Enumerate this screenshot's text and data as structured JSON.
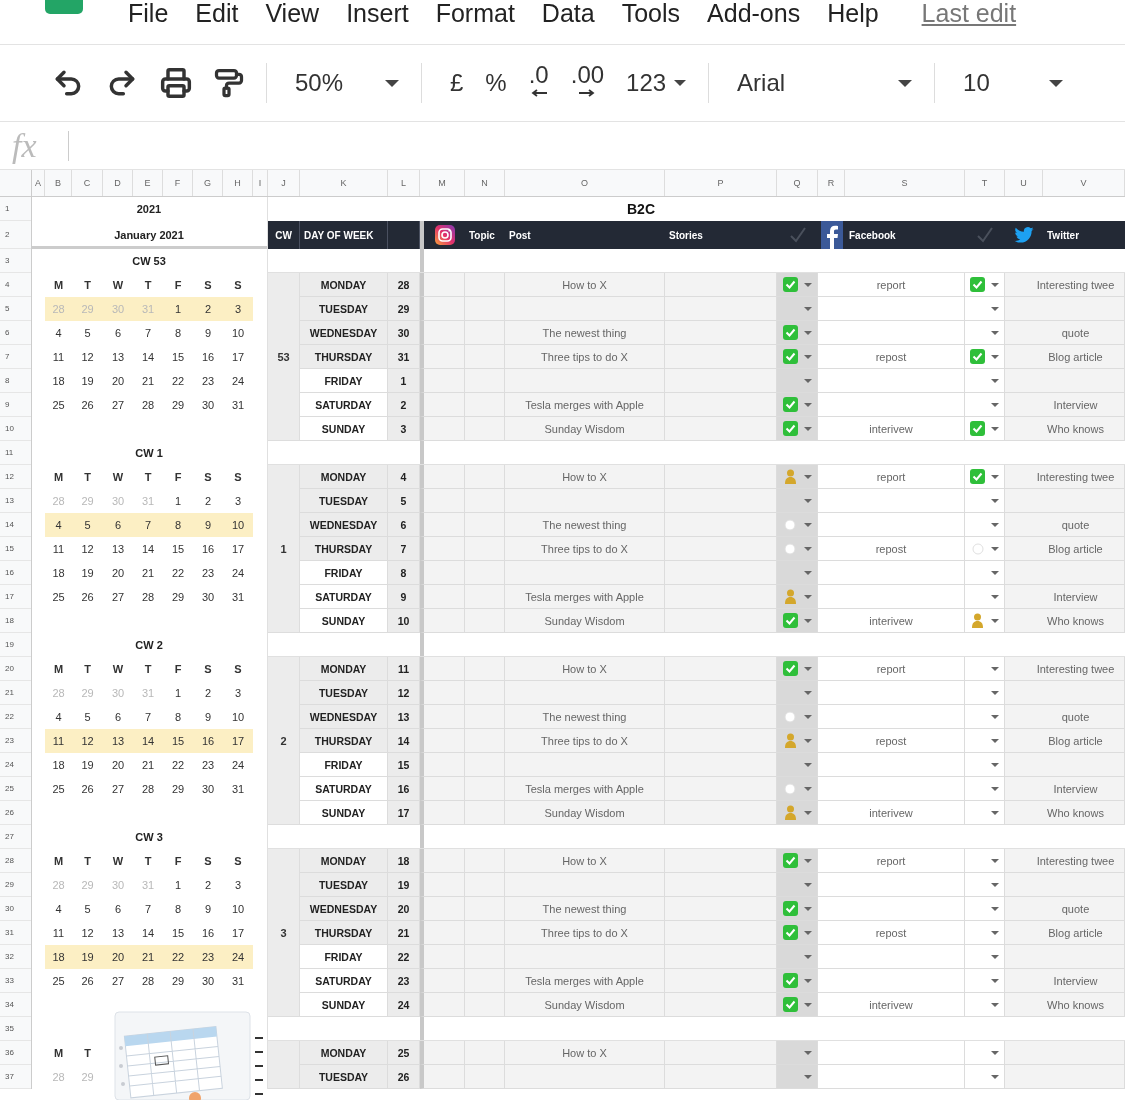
{
  "menu": {
    "items": [
      "File",
      "Edit",
      "View",
      "Insert",
      "Format",
      "Data",
      "Tools",
      "Add-ons",
      "Help"
    ],
    "last_edit": "Last edit"
  },
  "toolbar": {
    "zoom": "50%",
    "currency": "£",
    "percent": "%",
    "decrease_decimals": ".0",
    "increase_decimals": ".00",
    "number_format": "123",
    "font": "Arial",
    "font_size": "10"
  },
  "formula_bar": {
    "label": "fx"
  },
  "columns": [
    "A",
    "B",
    "C",
    "D",
    "E",
    "F",
    "G",
    "H",
    "I",
    "J",
    "K",
    "L",
    "M",
    "N",
    "O",
    "P",
    "Q",
    "R",
    "S",
    "T",
    "U",
    "V"
  ],
  "row_numbers": [
    "1",
    "2",
    "3",
    "4",
    "5",
    "6",
    "7",
    "8",
    "9",
    "10",
    "11",
    "12",
    "13",
    "14",
    "15",
    "16",
    "17",
    "18",
    "19",
    "20",
    "21",
    "22",
    "23",
    "24",
    "25",
    "26",
    "27",
    "28",
    "29",
    "30",
    "31",
    "32",
    "33",
    "34",
    "35",
    "36",
    "37"
  ],
  "calendar": {
    "year": "2021",
    "month": "January 2021",
    "blocks": [
      {
        "title": "CW 53",
        "headers": [
          "M",
          "T",
          "W",
          "T",
          "F",
          "S",
          "S"
        ],
        "weeks": [
          {
            "days": [
              "28",
              "29",
              "30",
              "31",
              "1",
              "2",
              "3"
            ],
            "muted": [
              true,
              true,
              true,
              true,
              false,
              false,
              false
            ],
            "highlighted": true
          },
          {
            "days": [
              "4",
              "5",
              "6",
              "7",
              "8",
              "9",
              "10"
            ],
            "muted": [
              false,
              false,
              false,
              false,
              false,
              false,
              false
            ],
            "highlighted": false
          },
          {
            "days": [
              "11",
              "12",
              "13",
              "14",
              "15",
              "16",
              "17"
            ],
            "muted": [
              false,
              false,
              false,
              false,
              false,
              false,
              false
            ],
            "highlighted": false
          },
          {
            "days": [
              "18",
              "19",
              "20",
              "21",
              "22",
              "23",
              "24"
            ],
            "muted": [
              false,
              false,
              false,
              false,
              false,
              false,
              false
            ],
            "highlighted": false
          },
          {
            "days": [
              "25",
              "26",
              "27",
              "28",
              "29",
              "30",
              "31"
            ],
            "muted": [
              false,
              false,
              false,
              false,
              false,
              false,
              false
            ],
            "highlighted": false
          }
        ]
      },
      {
        "title": "CW 1",
        "headers": [
          "M",
          "T",
          "W",
          "T",
          "F",
          "S",
          "S"
        ],
        "weeks": [
          {
            "days": [
              "28",
              "29",
              "30",
              "31",
              "1",
              "2",
              "3"
            ],
            "muted": [
              true,
              true,
              true,
              true,
              false,
              false,
              false
            ],
            "highlighted": false
          },
          {
            "days": [
              "4",
              "5",
              "6",
              "7",
              "8",
              "9",
              "10"
            ],
            "muted": [
              false,
              false,
              false,
              false,
              false,
              false,
              false
            ],
            "highlighted": true
          },
          {
            "days": [
              "11",
              "12",
              "13",
              "14",
              "15",
              "16",
              "17"
            ],
            "muted": [
              false,
              false,
              false,
              false,
              false,
              false,
              false
            ],
            "highlighted": false
          },
          {
            "days": [
              "18",
              "19",
              "20",
              "21",
              "22",
              "23",
              "24"
            ],
            "muted": [
              false,
              false,
              false,
              false,
              false,
              false,
              false
            ],
            "highlighted": false
          },
          {
            "days": [
              "25",
              "26",
              "27",
              "28",
              "29",
              "30",
              "31"
            ],
            "muted": [
              false,
              false,
              false,
              false,
              false,
              false,
              false
            ],
            "highlighted": false
          }
        ]
      },
      {
        "title": "CW 2",
        "headers": [
          "M",
          "T",
          "W",
          "T",
          "F",
          "S",
          "S"
        ],
        "weeks": [
          {
            "days": [
              "28",
              "29",
              "30",
              "31",
              "1",
              "2",
              "3"
            ],
            "muted": [
              true,
              true,
              true,
              true,
              false,
              false,
              false
            ],
            "highlighted": false
          },
          {
            "days": [
              "4",
              "5",
              "6",
              "7",
              "8",
              "9",
              "10"
            ],
            "muted": [
              false,
              false,
              false,
              false,
              false,
              false,
              false
            ],
            "highlighted": false
          },
          {
            "days": [
              "11",
              "12",
              "13",
              "14",
              "15",
              "16",
              "17"
            ],
            "muted": [
              false,
              false,
              false,
              false,
              false,
              false,
              false
            ],
            "highlighted": true
          },
          {
            "days": [
              "18",
              "19",
              "20",
              "21",
              "22",
              "23",
              "24"
            ],
            "muted": [
              false,
              false,
              false,
              false,
              false,
              false,
              false
            ],
            "highlighted": false
          },
          {
            "days": [
              "25",
              "26",
              "27",
              "28",
              "29",
              "30",
              "31"
            ],
            "muted": [
              false,
              false,
              false,
              false,
              false,
              false,
              false
            ],
            "highlighted": false
          }
        ]
      },
      {
        "title": "CW 3",
        "headers": [
          "M",
          "T",
          "W",
          "T",
          "F",
          "S",
          "S"
        ],
        "weeks": [
          {
            "days": [
              "28",
              "29",
              "30",
              "31",
              "1",
              "2",
              "3"
            ],
            "muted": [
              true,
              true,
              true,
              true,
              false,
              false,
              false
            ],
            "highlighted": false
          },
          {
            "days": [
              "4",
              "5",
              "6",
              "7",
              "8",
              "9",
              "10"
            ],
            "muted": [
              false,
              false,
              false,
              false,
              false,
              false,
              false
            ],
            "highlighted": false
          },
          {
            "days": [
              "11",
              "12",
              "13",
              "14",
              "15",
              "16",
              "17"
            ],
            "muted": [
              false,
              false,
              false,
              false,
              false,
              false,
              false
            ],
            "highlighted": false
          },
          {
            "days": [
              "18",
              "19",
              "20",
              "21",
              "22",
              "23",
              "24"
            ],
            "muted": [
              false,
              false,
              false,
              false,
              false,
              false,
              false
            ],
            "highlighted": true
          },
          {
            "days": [
              "25",
              "26",
              "27",
              "28",
              "29",
              "30",
              "31"
            ],
            "muted": [
              false,
              false,
              false,
              false,
              false,
              false,
              false
            ],
            "highlighted": false
          }
        ]
      },
      {
        "headers": [
          "M",
          "T"
        ],
        "weeks": [
          {
            "days": [
              "28",
              "29"
            ],
            "muted": [
              true,
              true
            ],
            "highlighted": false
          }
        ]
      }
    ]
  },
  "b2c": {
    "title": "B2C",
    "header": {
      "cw": "CW",
      "day": "DAY OF WEEK",
      "topic": "Topic",
      "post": "Post",
      "stories": "Stories",
      "facebook": "Facebook",
      "twitter": "Twitter"
    },
    "groups": [
      {
        "cw": "53",
        "days": [
          {
            "day": "MONDAY",
            "date": "28",
            "shaded": true,
            "post": "How to X",
            "instagram_status": {
              "kind": "checked"
            },
            "facebook": "report",
            "facebook_status": {
              "kind": "checked"
            },
            "twitter": "Interesting twee"
          },
          {
            "day": "TUESDAY",
            "date": "29",
            "shaded": true
          },
          {
            "day": "WEDNESDAY",
            "date": "30",
            "shaded": true,
            "post": "The newest thing",
            "instagram_status": {
              "kind": "checked"
            },
            "twitter": "quote"
          },
          {
            "day": "THURSDAY",
            "date": "31",
            "shaded": true,
            "post": "Three tips to do X",
            "instagram_status": {
              "kind": "checked"
            },
            "facebook": "repost",
            "facebook_status": {
              "kind": "checked"
            },
            "twitter": "Blog article"
          },
          {
            "day": "FRIDAY",
            "date": "1",
            "shaded": false
          },
          {
            "day": "SATURDAY",
            "date": "2",
            "shaded": false,
            "post": "Tesla merges with Apple",
            "instagram_status": {
              "kind": "checked"
            },
            "twitter": "Interview"
          },
          {
            "day": "SUNDAY",
            "date": "3",
            "shaded": false,
            "post": "Sunday Wisdom",
            "instagram_status": {
              "kind": "checked"
            },
            "facebook": "interivew",
            "facebook_status": {
              "kind": "checked"
            },
            "twitter": "Who knows"
          }
        ]
      },
      {
        "cw": "1",
        "days": [
          {
            "day": "MONDAY",
            "date": "4",
            "shaded": true,
            "post": "How to X",
            "instagram_status": {
              "kind": "pending"
            },
            "facebook": "report",
            "facebook_status": {
              "kind": "checked"
            },
            "twitter": "Interesting twee"
          },
          {
            "day": "TUESDAY",
            "date": "5",
            "shaded": true
          },
          {
            "day": "WEDNESDAY",
            "date": "6",
            "shaded": true,
            "post": "The newest thing",
            "instagram_status": {
              "kind": "open"
            },
            "twitter": "quote"
          },
          {
            "day": "THURSDAY",
            "date": "7",
            "shaded": true,
            "post": "Three tips to do X",
            "instagram_status": {
              "kind": "open"
            },
            "facebook": "repost",
            "facebook_status": {
              "kind": "open"
            },
            "twitter": "Blog article"
          },
          {
            "day": "FRIDAY",
            "date": "8",
            "shaded": false
          },
          {
            "day": "SATURDAY",
            "date": "9",
            "shaded": false,
            "post": "Tesla merges with Apple",
            "instagram_status": {
              "kind": "pending"
            },
            "twitter": "Interview"
          },
          {
            "day": "SUNDAY",
            "date": "10",
            "shaded": false,
            "post": "Sunday Wisdom",
            "instagram_status": {
              "kind": "checked"
            },
            "facebook": "interivew",
            "facebook_status": {
              "kind": "pending"
            },
            "twitter": "Who knows"
          }
        ]
      },
      {
        "cw": "2",
        "days": [
          {
            "day": "MONDAY",
            "date": "11",
            "shaded": true,
            "post": "How to X",
            "instagram_status": {
              "kind": "checked"
            },
            "facebook": "report",
            "twitter": "Interesting twee"
          },
          {
            "day": "TUESDAY",
            "date": "12",
            "shaded": true
          },
          {
            "day": "WEDNESDAY",
            "date": "13",
            "shaded": true,
            "post": "The newest thing",
            "instagram_status": {
              "kind": "open"
            },
            "twitter": "quote"
          },
          {
            "day": "THURSDAY",
            "date": "14",
            "shaded": true,
            "post": "Three tips to do X",
            "instagram_status": {
              "kind": "pending"
            },
            "facebook": "repost",
            "twitter": "Blog article"
          },
          {
            "day": "FRIDAY",
            "date": "15",
            "shaded": false
          },
          {
            "day": "SATURDAY",
            "date": "16",
            "shaded": false,
            "post": "Tesla merges with Apple",
            "instagram_status": {
              "kind": "open"
            },
            "twitter": "Interview"
          },
          {
            "day": "SUNDAY",
            "date": "17",
            "shaded": false,
            "post": "Sunday Wisdom",
            "instagram_status": {
              "kind": "pending"
            },
            "facebook": "interivew",
            "twitter": "Who knows"
          }
        ]
      },
      {
        "cw": "3",
        "days": [
          {
            "day": "MONDAY",
            "date": "18",
            "shaded": true,
            "post": "How to X",
            "instagram_status": {
              "kind": "checked"
            },
            "facebook": "report",
            "twitter": "Interesting twee"
          },
          {
            "day": "TUESDAY",
            "date": "19",
            "shaded": true
          },
          {
            "day": "WEDNESDAY",
            "date": "20",
            "shaded": true,
            "post": "The newest thing",
            "instagram_status": {
              "kind": "checked"
            },
            "twitter": "quote"
          },
          {
            "day": "THURSDAY",
            "date": "21",
            "shaded": true,
            "post": "Three tips to do X",
            "instagram_status": {
              "kind": "checked"
            },
            "facebook": "repost",
            "twitter": "Blog article"
          },
          {
            "day": "FRIDAY",
            "date": "22",
            "shaded": false
          },
          {
            "day": "SATURDAY",
            "date": "23",
            "shaded": false,
            "post": "Tesla merges with Apple",
            "instagram_status": {
              "kind": "checked"
            },
            "twitter": "Interview"
          },
          {
            "day": "SUNDAY",
            "date": "24",
            "shaded": false,
            "post": "Sunday Wisdom",
            "instagram_status": {
              "kind": "checked"
            },
            "facebook": "interivew",
            "twitter": "Who knows"
          }
        ]
      },
      {
        "days": [
          {
            "day": "MONDAY",
            "date": "25",
            "shaded": true,
            "post": "How to X"
          },
          {
            "day": "TUESDAY",
            "date": "26",
            "shaded": true
          }
        ]
      }
    ]
  }
}
